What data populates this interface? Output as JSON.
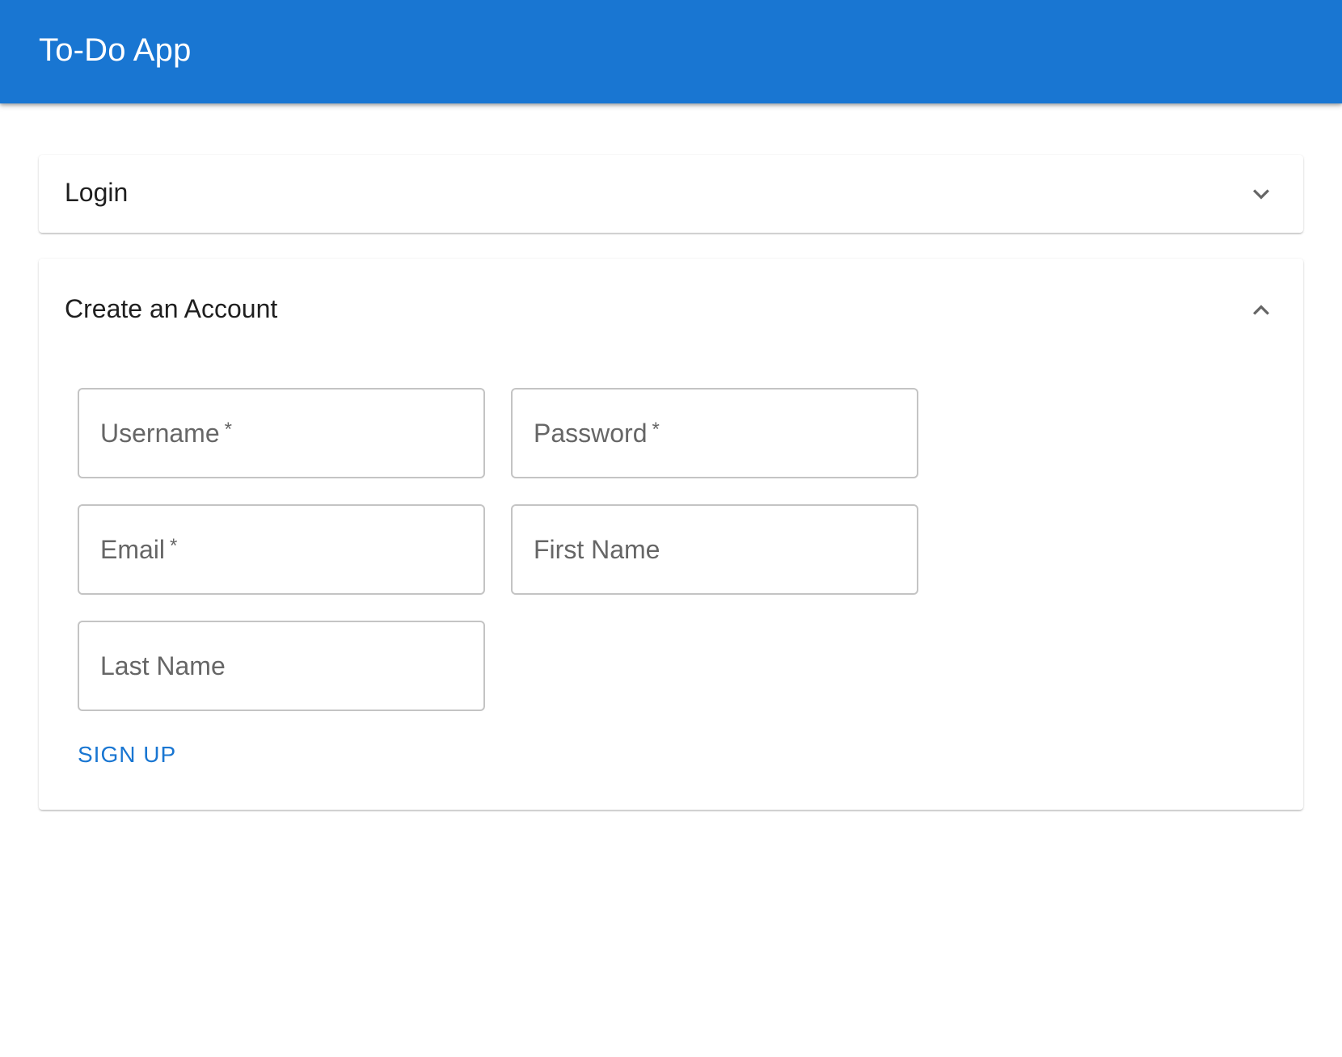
{
  "appbar": {
    "title": "To-Do App",
    "color": "#1976d2"
  },
  "login_panel": {
    "title": "Login",
    "expanded": false,
    "icon": "chevron-down-icon"
  },
  "signup_panel": {
    "title": "Create an Account",
    "expanded": true,
    "icon": "chevron-up-icon",
    "fields": {
      "username": {
        "label": "Username",
        "required_mark": "*"
      },
      "password": {
        "label": "Password",
        "required_mark": "*"
      },
      "email": {
        "label": "Email",
        "required_mark": "*"
      },
      "first_name": {
        "label": "First Name"
      },
      "last_name": {
        "label": "Last Name"
      }
    },
    "submit_label": "SIGN UP"
  }
}
